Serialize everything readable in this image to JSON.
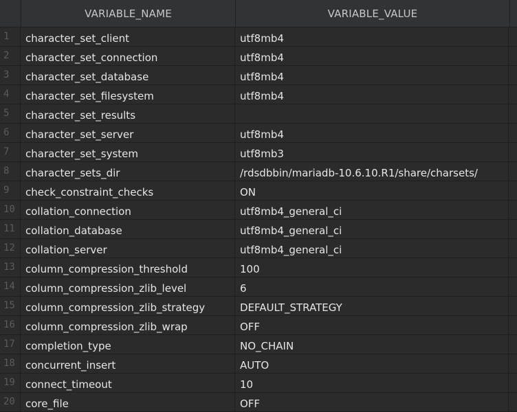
{
  "grid": {
    "columns": [
      "VARIABLE_NAME",
      "VARIABLE_VALUE"
    ],
    "rows": [
      {
        "num": "1",
        "name": "character_set_client",
        "value": "utf8mb4"
      },
      {
        "num": "2",
        "name": "character_set_connection",
        "value": "utf8mb4"
      },
      {
        "num": "3",
        "name": "character_set_database",
        "value": "utf8mb4"
      },
      {
        "num": "4",
        "name": "character_set_filesystem",
        "value": "utf8mb4"
      },
      {
        "num": "5",
        "name": "character_set_results",
        "value": ""
      },
      {
        "num": "6",
        "name": "character_set_server",
        "value": "utf8mb4"
      },
      {
        "num": "7",
        "name": "character_set_system",
        "value": "utf8mb3"
      },
      {
        "num": "8",
        "name": "character_sets_dir",
        "value": "/rdsdbbin/mariadb-10.6.10.R1/share/charsets/"
      },
      {
        "num": "9",
        "name": "check_constraint_checks",
        "value": "ON"
      },
      {
        "num": "10",
        "name": "collation_connection",
        "value": "utf8mb4_general_ci"
      },
      {
        "num": "11",
        "name": "collation_database",
        "value": "utf8mb4_general_ci"
      },
      {
        "num": "12",
        "name": "collation_server",
        "value": "utf8mb4_general_ci"
      },
      {
        "num": "13",
        "name": "column_compression_threshold",
        "value": "100"
      },
      {
        "num": "14",
        "name": "column_compression_zlib_level",
        "value": "6"
      },
      {
        "num": "15",
        "name": "column_compression_zlib_strategy",
        "value": "DEFAULT_STRATEGY"
      },
      {
        "num": "16",
        "name": "column_compression_zlib_wrap",
        "value": "OFF"
      },
      {
        "num": "17",
        "name": "completion_type",
        "value": "NO_CHAIN"
      },
      {
        "num": "18",
        "name": "concurrent_insert",
        "value": "AUTO"
      },
      {
        "num": "19",
        "name": "connect_timeout",
        "value": "10"
      },
      {
        "num": "20",
        "name": "core_file",
        "value": "OFF"
      }
    ]
  }
}
